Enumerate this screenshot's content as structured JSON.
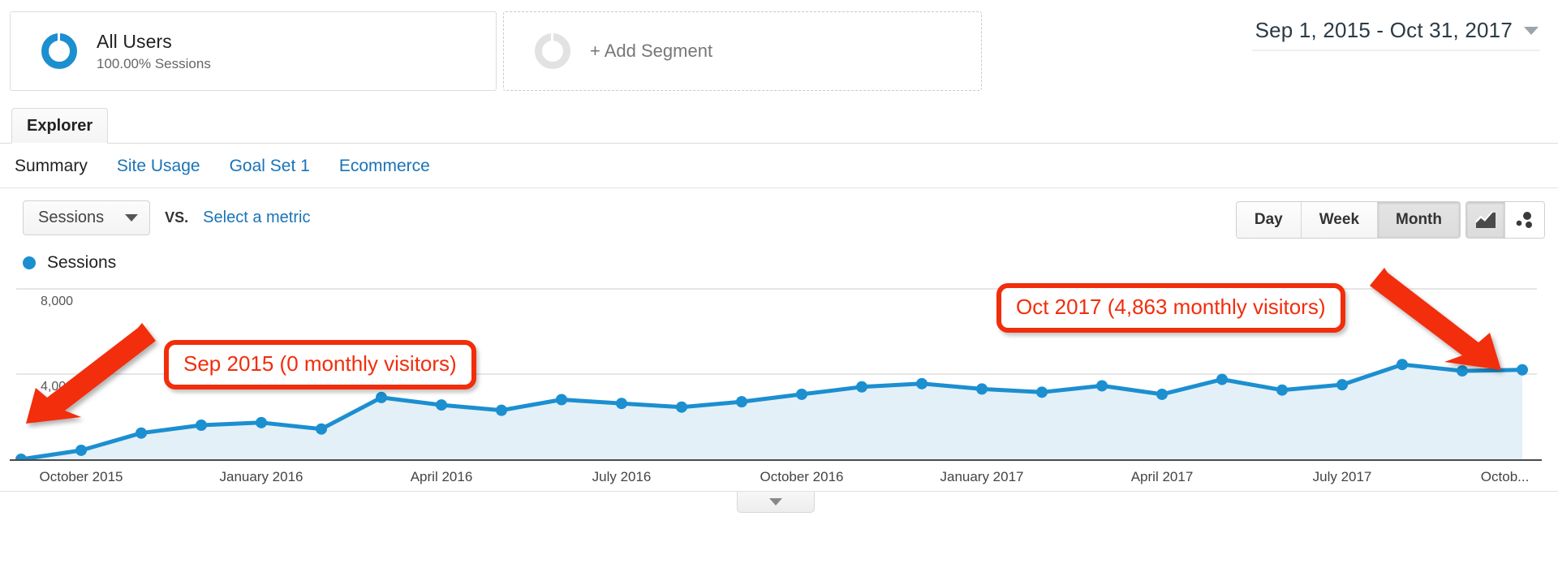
{
  "segment": {
    "title": "All Users",
    "subtitle": "100.00% Sessions",
    "donut_icon": "donut-icon",
    "accent_color": "#1b8fd0"
  },
  "add_segment": {
    "label": "+ Add Segment",
    "donut_icon": "donut-outline-icon"
  },
  "date_range": {
    "value": "Sep 1, 2015 - Oct 31, 2017",
    "caret_icon": "chevron-down-icon"
  },
  "tabs": {
    "explorer": "Explorer"
  },
  "subtabs": [
    {
      "label": "Summary",
      "active": true
    },
    {
      "label": "Site Usage",
      "active": false
    },
    {
      "label": "Goal Set 1",
      "active": false
    },
    {
      "label": "Ecommerce",
      "active": false
    }
  ],
  "metric_row": {
    "selected_metric": "Sessions",
    "vs_label": "VS.",
    "select_metric_link": "Select a metric",
    "caret_icon": "caret-down-icon"
  },
  "granularity": {
    "options": [
      "Day",
      "Week",
      "Month"
    ],
    "selected": "Month"
  },
  "chart_type_toggle": {
    "line_icon": "line-chart-icon",
    "motion_icon": "motion-chart-icon",
    "selected": "line-chart-icon"
  },
  "legend": {
    "label": "Sessions",
    "color": "#1b8fd0"
  },
  "annotations": [
    {
      "text": "Sep 2015 (0 monthly visitors)",
      "color": "#f22d0b",
      "arrow": "arrow-down-left"
    },
    {
      "text": "Oct 2017 (4,863 monthly visitors)",
      "color": "#f22d0b",
      "arrow": "arrow-down-right"
    }
  ],
  "expander": {
    "caret_icon": "chevron-down-icon"
  },
  "chart_data": {
    "type": "area",
    "title": "Sessions",
    "xlabel": "",
    "ylabel": "Sessions",
    "ylim": [
      0,
      8000
    ],
    "yticks": [
      4000,
      8000
    ],
    "ytick_labels": [
      "4,000",
      "8,000"
    ],
    "grid": true,
    "legend_position": "top-left",
    "line_color": "#1b8fd0",
    "fill_color": "#e4f0f8",
    "xtick_labels": [
      "October 2015",
      "January 2016",
      "April 2016",
      "July 2016",
      "October 2016",
      "January 2017",
      "April 2017",
      "July 2017",
      "Octob..."
    ],
    "x": [
      "Sep 2015",
      "Oct 2015",
      "Nov 2015",
      "Dec 2015",
      "Jan 2016",
      "Feb 2016",
      "Mar 2016",
      "Apr 2016",
      "May 2016",
      "Jun 2016",
      "Jul 2016",
      "Aug 2016",
      "Sep 2016",
      "Oct 2016",
      "Nov 2016",
      "Dec 2016",
      "Jan 2017",
      "Feb 2017",
      "Mar 2017",
      "Apr 2017",
      "May 2017",
      "Jun 2017",
      "Jul 2017",
      "Aug 2017",
      "Sep 2017",
      "Oct 2017"
    ],
    "values": [
      0,
      420,
      1230,
      1600,
      1720,
      1420,
      2900,
      2550,
      2300,
      2800,
      2620,
      2450,
      2700,
      3050,
      3400,
      3550,
      3300,
      3150,
      3450,
      3050,
      3750,
      3250,
      3500,
      4450,
      4150,
      4200
    ],
    "series": [
      {
        "name": "Sessions",
        "values": [
          0,
          420,
          1230,
          1600,
          1720,
          1420,
          2900,
          2550,
          2300,
          2800,
          2620,
          2450,
          2700,
          3050,
          3400,
          3550,
          3300,
          3150,
          3450,
          3050,
          3750,
          3250,
          3500,
          4450,
          4150,
          4200
        ]
      }
    ],
    "annotated_points": [
      {
        "x": "Sep 2015",
        "label": "Sep 2015 (0 monthly visitors)",
        "value": 0
      },
      {
        "x": "Oct 2017",
        "label": "Oct 2017 (4,863 monthly visitors)",
        "value": 4863
      }
    ]
  }
}
